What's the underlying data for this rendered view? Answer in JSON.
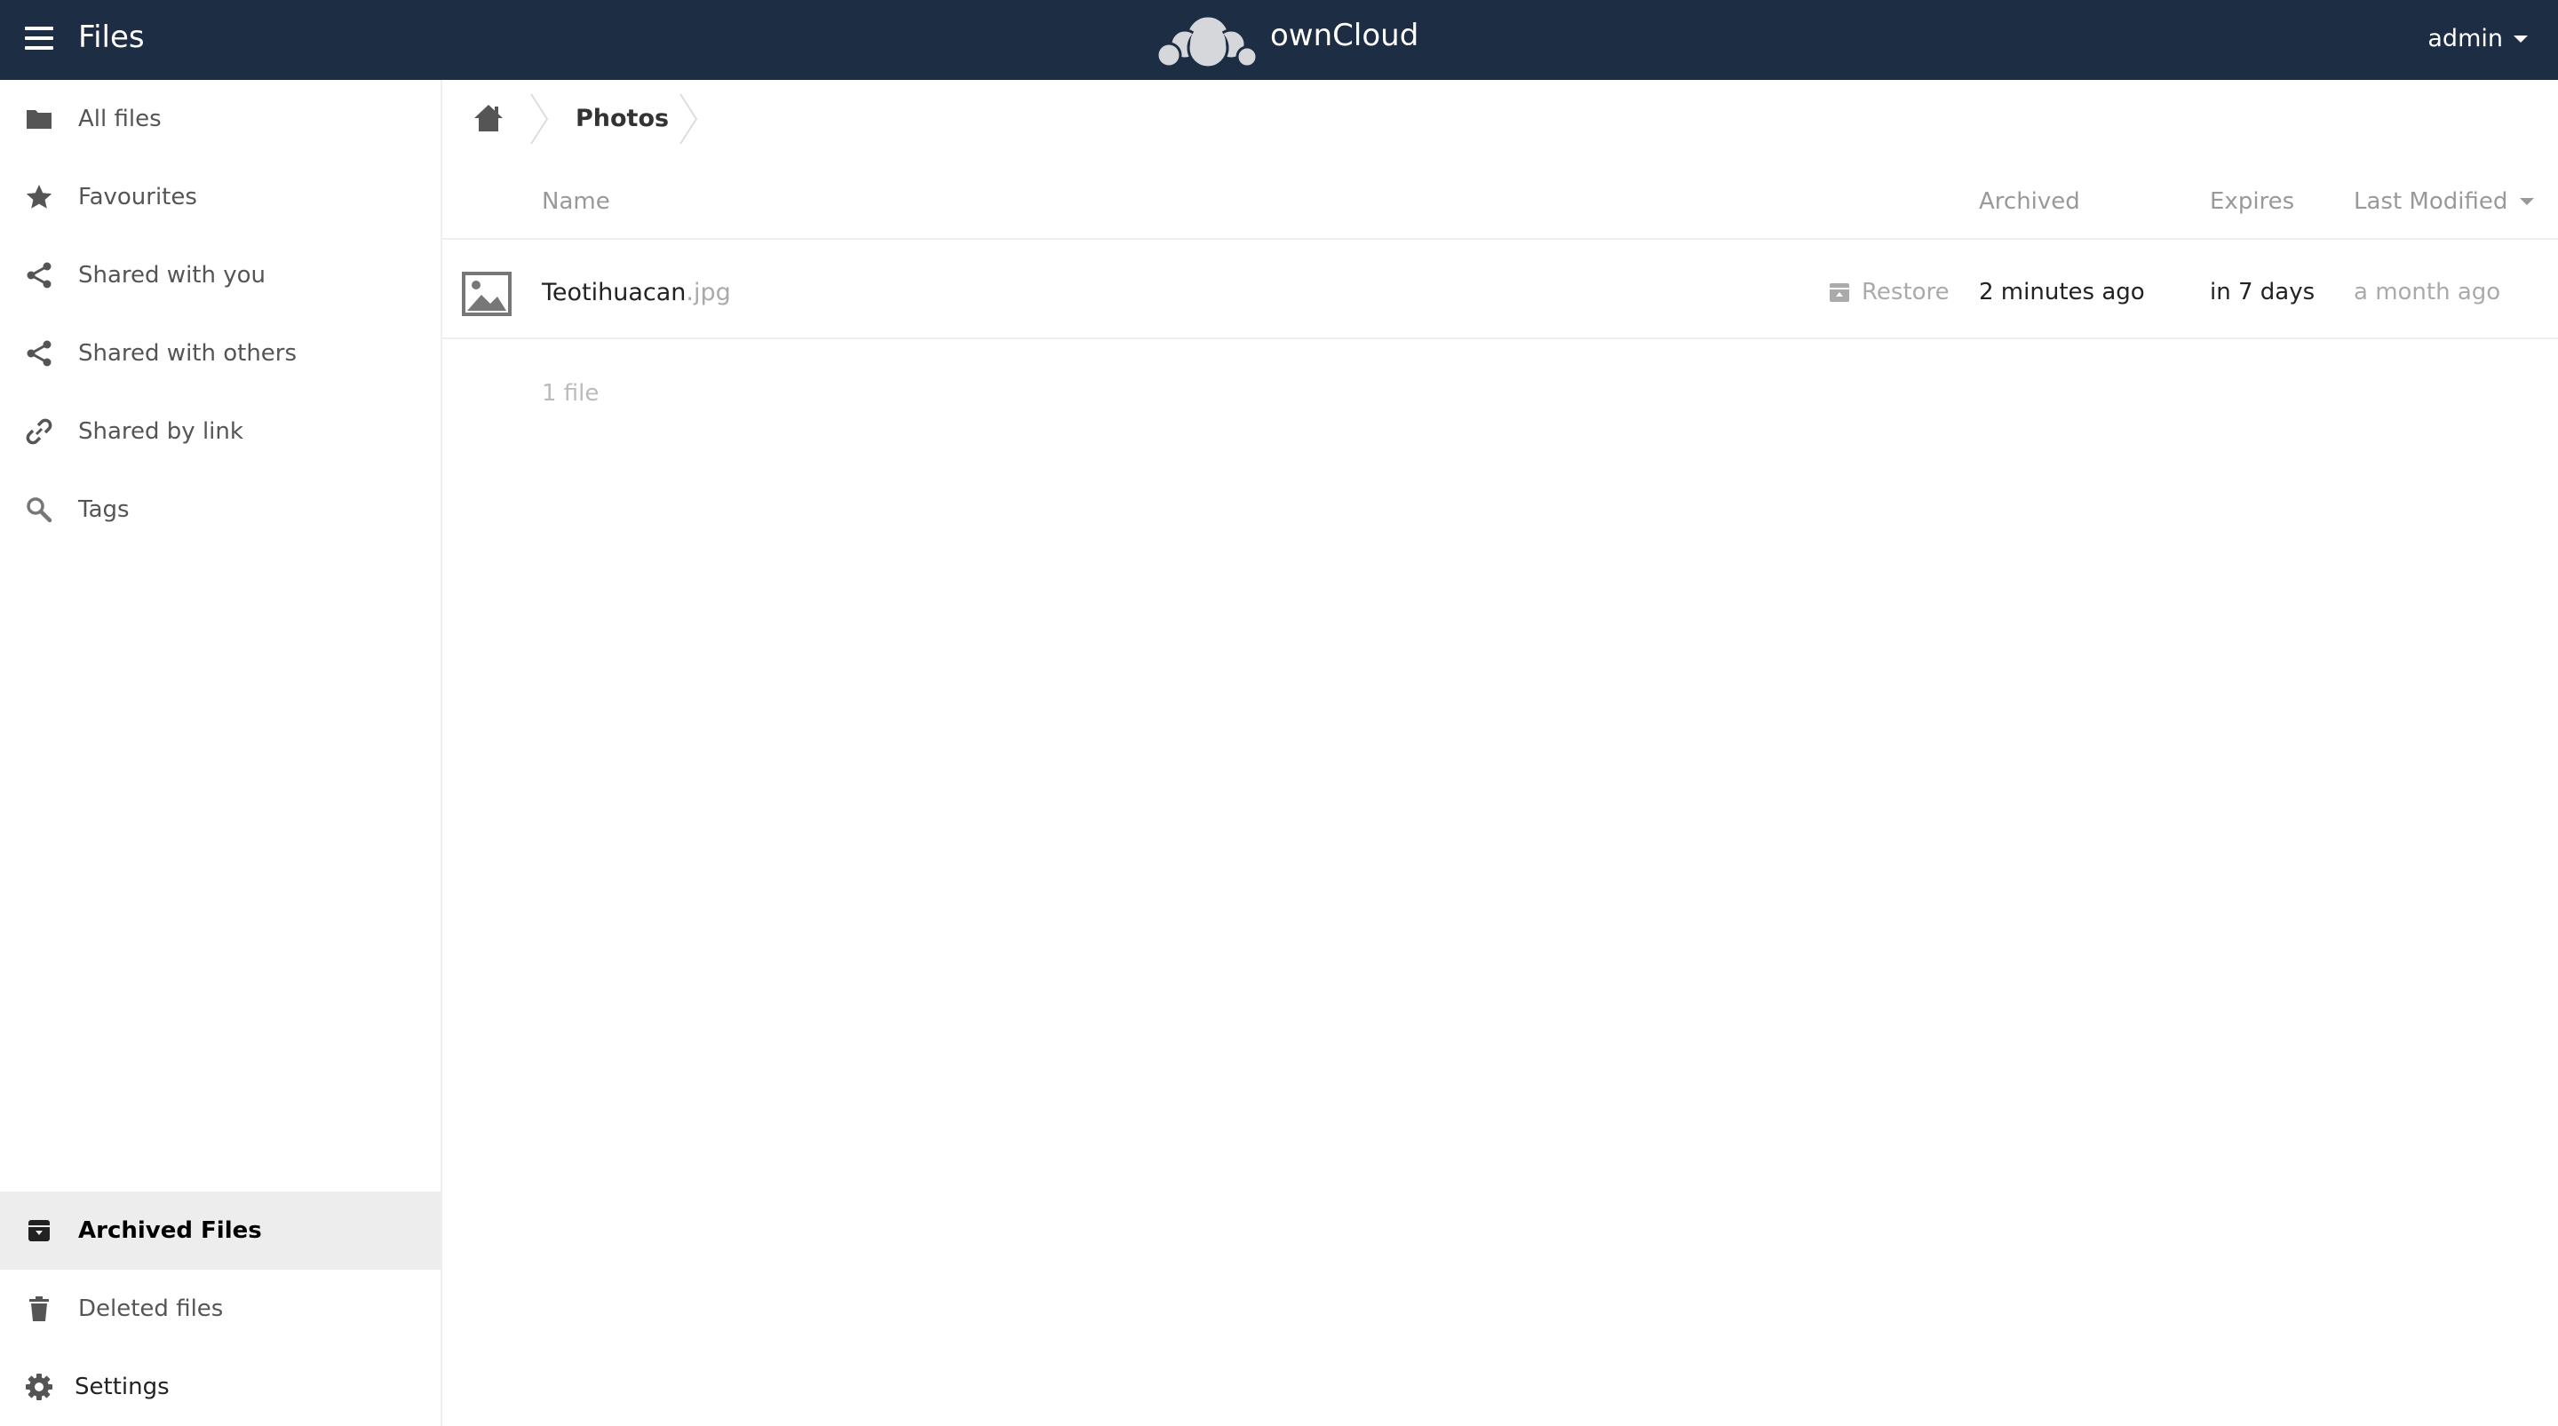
{
  "header": {
    "app_title": "Files",
    "brand": "ownCloud",
    "user": "admin",
    "background": "#1d2d44"
  },
  "sidebar": {
    "items": [
      {
        "label": "All files",
        "icon": "folder-icon"
      },
      {
        "label": "Favourites",
        "icon": "star-icon"
      },
      {
        "label": "Shared with you",
        "icon": "share-icon"
      },
      {
        "label": "Shared with others",
        "icon": "share-icon"
      },
      {
        "label": "Shared by link",
        "icon": "link-icon"
      },
      {
        "label": "Tags",
        "icon": "search-icon"
      }
    ],
    "bottom_items": [
      {
        "label": "Archived Files",
        "icon": "archive-icon",
        "active": true
      },
      {
        "label": "Deleted files",
        "icon": "trash-icon"
      },
      {
        "label": "Settings",
        "icon": "gear-icon"
      }
    ]
  },
  "breadcrumb": {
    "current": "Photos"
  },
  "table": {
    "columns": {
      "name": "Name",
      "archived": "Archived",
      "expires": "Expires",
      "last_modified": "Last Modified"
    },
    "rows": [
      {
        "name": "Teotihuacan",
        "extension": ".jpg",
        "action": "Restore",
        "archived": "2 minutes ago",
        "expires": "in 7 days",
        "last_modified": "a month ago"
      }
    ],
    "summary": "1 file"
  }
}
